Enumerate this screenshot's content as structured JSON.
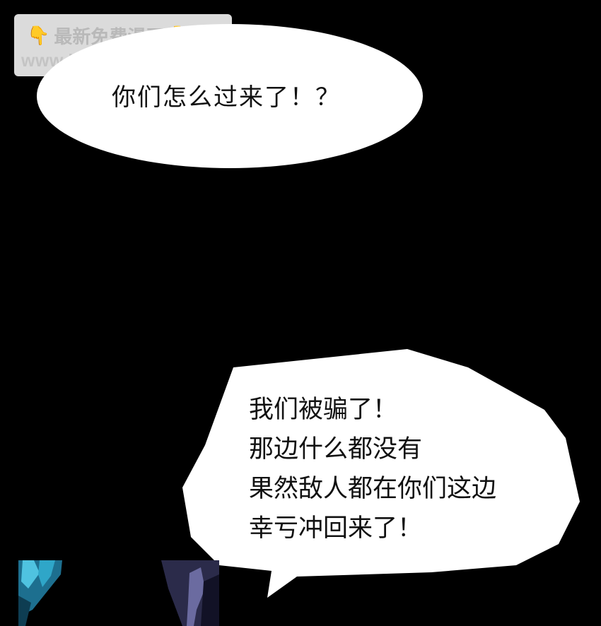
{
  "watermark": {
    "line1": "最新免费漫画",
    "line2": "www.baozimh.com",
    "hand_icon": "👇"
  },
  "speech_bubble_top": {
    "text": "你们怎么过来了！？"
  },
  "speech_bubble_bottom": {
    "lines": [
      "我们被骗了！",
      "那边什么都没有",
      "果然敌人都在你们这边",
      "幸亏冲回来了！"
    ]
  },
  "colors": {
    "background": "#000000",
    "bubble": "#ffffff",
    "text": "#111111",
    "fragment_left": "#2a8fb0",
    "fragment_mid": "#4a4a7a"
  }
}
